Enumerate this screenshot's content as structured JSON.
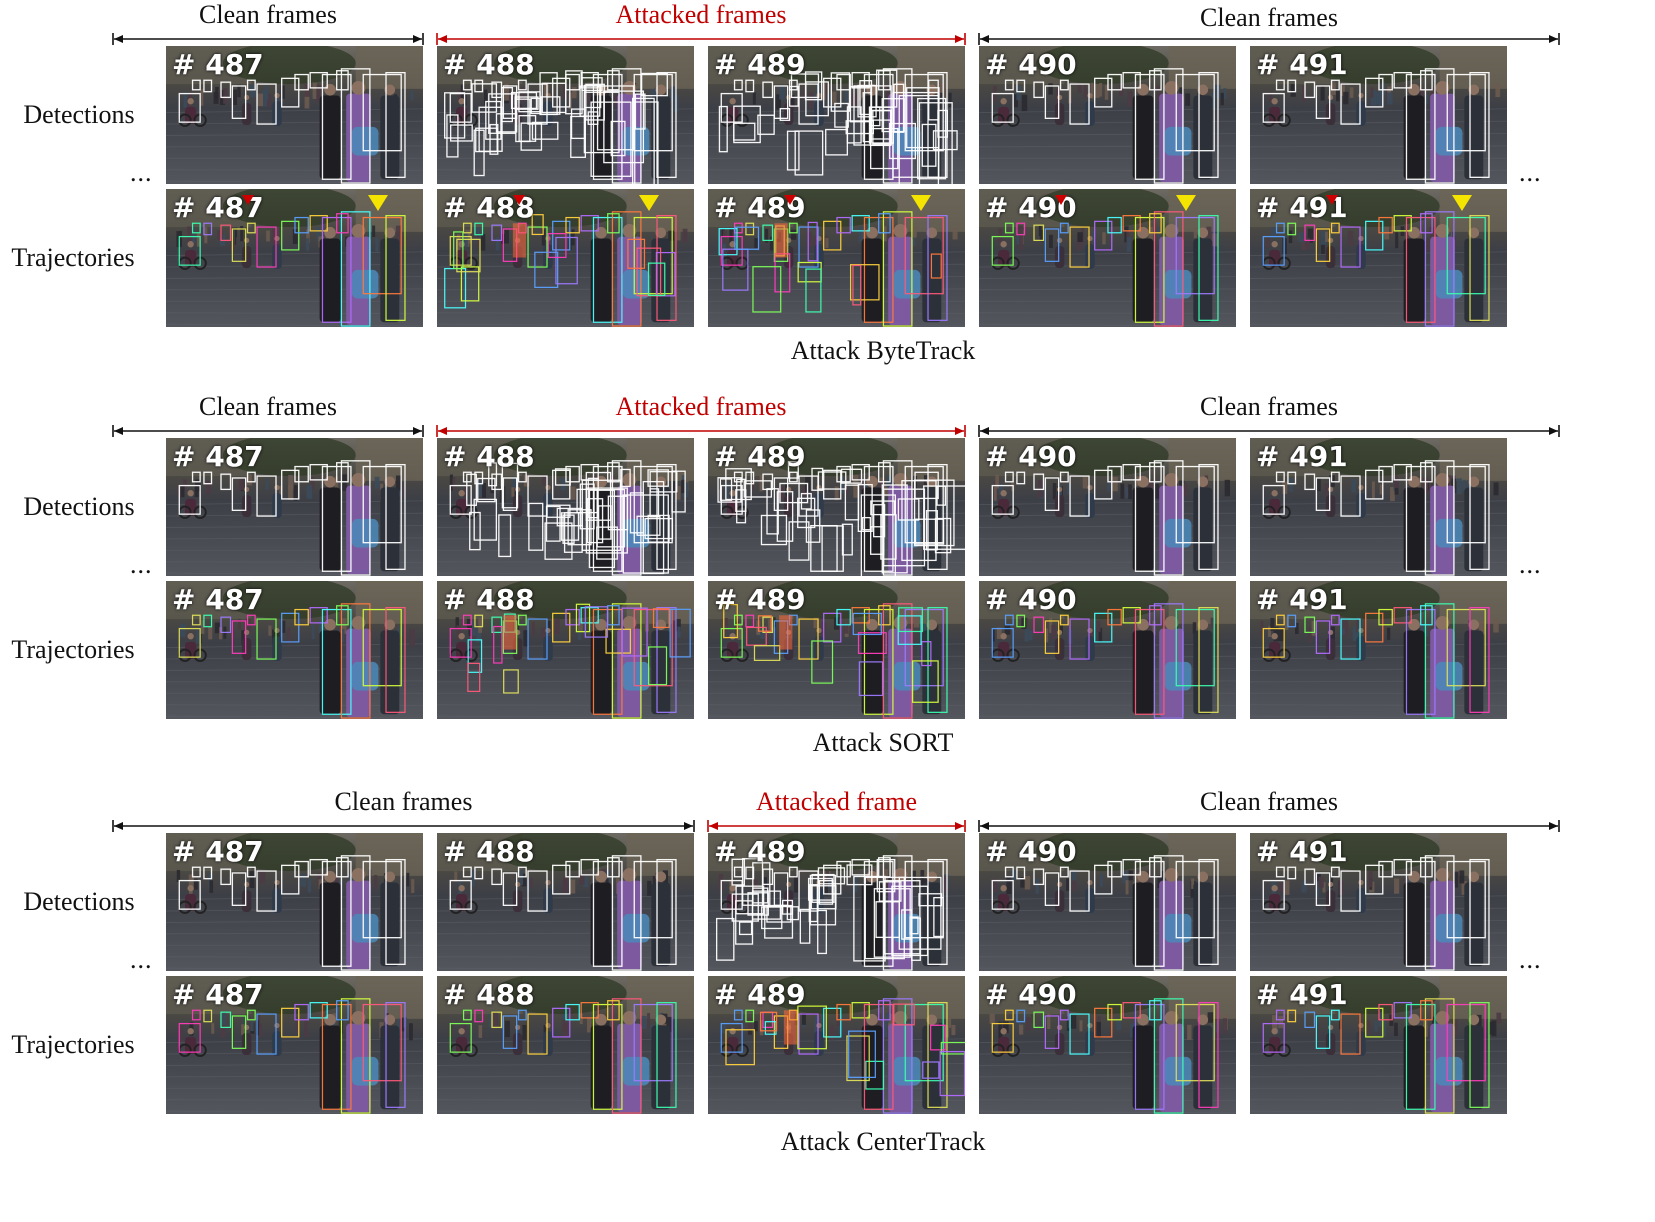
{
  "sections": [
    {
      "caption": "Attack ByteTrack",
      "spans": [
        {
          "label": "Clean frames",
          "attacked": false,
          "from": 0,
          "to": 0
        },
        {
          "label": "Attacked frames",
          "attacked": true,
          "from": 1,
          "to": 2
        },
        {
          "label": "Clean frames",
          "attacked": false,
          "from": 3,
          "to": 4
        }
      ],
      "attacked_frames": [
        1,
        2
      ],
      "markers": true
    },
    {
      "caption": "Attack SORT",
      "spans": [
        {
          "label": "Clean frames",
          "attacked": false,
          "from": 0,
          "to": 0
        },
        {
          "label": "Attacked frames",
          "attacked": true,
          "from": 1,
          "to": 2
        },
        {
          "label": "Clean frames",
          "attacked": false,
          "from": 3,
          "to": 4
        }
      ],
      "attacked_frames": [
        1,
        2
      ],
      "markers": false
    },
    {
      "caption": "Attack CenterTrack",
      "spans": [
        {
          "label": "Clean frames",
          "attacked": false,
          "from": 0,
          "to": 1
        },
        {
          "label": "Attacked frame",
          "attacked": true,
          "from": 2,
          "to": 2
        },
        {
          "label": "Clean frames",
          "attacked": false,
          "from": 3,
          "to": 4
        }
      ],
      "attacked_frames": [
        2
      ],
      "markers": false
    }
  ],
  "row_labels": {
    "detections": "Detections",
    "trajectories": "Trajectories"
  },
  "frame_numbers": [
    "# 487",
    "# 488",
    "# 489",
    "# 490",
    "# 491"
  ],
  "ellipsis": "...",
  "colors": {
    "attack": "#c00000",
    "arrow": "#111111",
    "marker": "#f5e400",
    "detection_box": "#ffffff"
  }
}
